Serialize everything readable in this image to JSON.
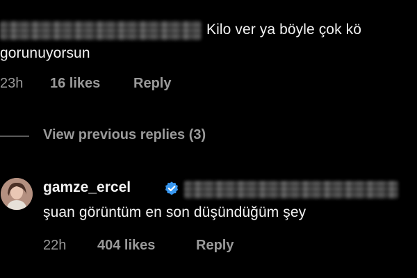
{
  "first_comment": {
    "text_part1": "Kilo ver ya  böyle çok kö",
    "text_part2": "gorunuyorsun",
    "time": "23h",
    "likes": "16 likes",
    "reply_label": "Reply"
  },
  "replies": {
    "view_previous_label": "View previous replies (3)"
  },
  "reply_comment": {
    "username": "gamze_ercel",
    "text": "şuan görüntüm en son düşündüğüm şey",
    "time": "22h",
    "likes": "404 likes",
    "reply_label": "Reply"
  },
  "colors": {
    "background": "#000000",
    "primary_text": "#f2f2f2",
    "secondary_text": "#9a9a9a",
    "verified_badge": "#3897f0"
  }
}
